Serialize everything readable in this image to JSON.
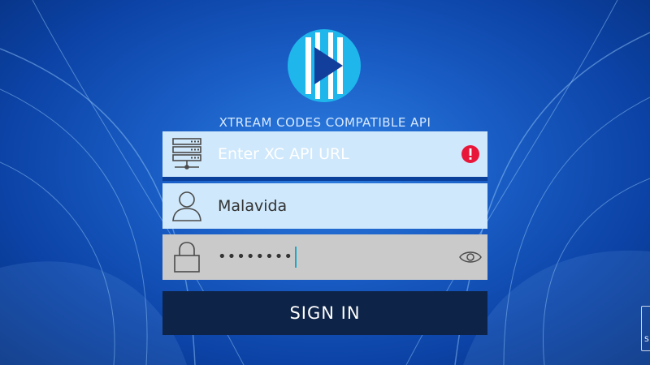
{
  "header": {
    "logo_icon": "play-logo-icon",
    "api_title": "XTREAM CODES COMPATIBLE API"
  },
  "form": {
    "url": {
      "icon": "server-icon",
      "placeholder": "Enter XC API URL",
      "value": "",
      "status_icon": "error-icon",
      "status_color": "#e8173a"
    },
    "username": {
      "icon": "user-icon",
      "value": "Malavida"
    },
    "password": {
      "icon": "lock-icon",
      "masked_value": "••••••••",
      "toggle_icon": "eye-icon"
    },
    "sign_in_label": "SIGN IN"
  },
  "corner": {
    "label": "S"
  },
  "colors": {
    "field_bg": "#cfe8fb",
    "password_bg": "#cacaca",
    "button_bg": "#0d2347",
    "accent": "#1aa9c9"
  }
}
